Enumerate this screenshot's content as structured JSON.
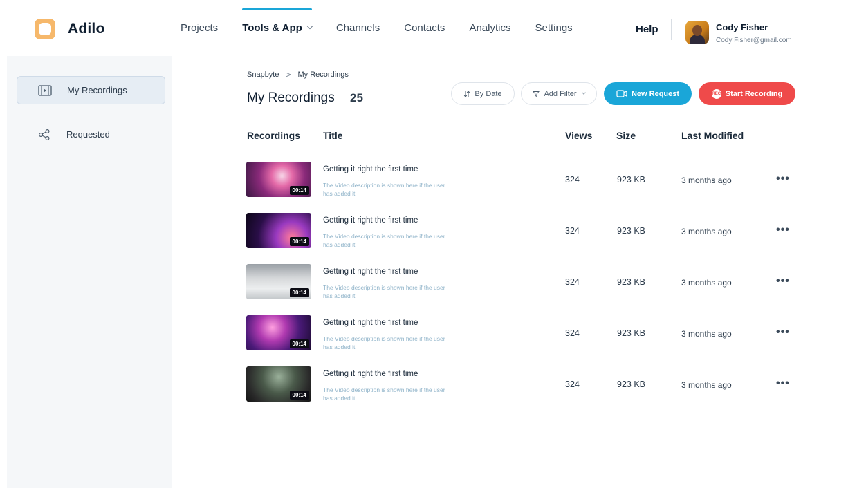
{
  "app": {
    "name": "Adilo"
  },
  "nav": {
    "items": [
      {
        "label": "Projects",
        "active": false
      },
      {
        "label": "Tools & App",
        "active": true
      },
      {
        "label": "Channels",
        "active": false
      },
      {
        "label": "Contacts",
        "active": false
      },
      {
        "label": "Analytics",
        "active": false
      },
      {
        "label": "Settings",
        "active": false
      }
    ],
    "help": "Help"
  },
  "user": {
    "name": "Cody Fisher",
    "email": "Cody Fisher@gmail.com"
  },
  "sidebar": {
    "items": [
      {
        "label": "My Recordings",
        "icon": "film-icon",
        "active": true
      },
      {
        "label": "Requested",
        "icon": "share-icon",
        "active": false
      }
    ]
  },
  "breadcrumb": {
    "root": "Snapbyte",
    "separator": ">",
    "current": "My Recordings"
  },
  "page": {
    "title": "My Recordings",
    "count": "25"
  },
  "toolbar": {
    "sort_label": "By Date",
    "filter_label": "Add Filter",
    "new_request_label": "New Request",
    "start_recording_label": "Start Recording",
    "rec_badge": "REC"
  },
  "table": {
    "headers": {
      "recordings": "Recordings",
      "title": "Title",
      "views": "Views",
      "size": "Size",
      "modified": "Last Modified"
    },
    "rows": [
      {
        "duration": "00:14",
        "title": "Getting it right the first time",
        "description": "The Video description is shown here if the user has added it.",
        "views": "324",
        "size": "923 KB",
        "modified": "3 months ago",
        "more": "•••"
      },
      {
        "duration": "00:14",
        "title": "Getting it right the first time",
        "description": "The Video description is shown here if the user has added it.",
        "views": "324",
        "size": "923 KB",
        "modified": "3 months ago",
        "more": "•••"
      },
      {
        "duration": "00:14",
        "title": "Getting it right the first time",
        "description": "The Video description is shown here if the user has added it.",
        "views": "324",
        "size": "923 KB",
        "modified": "3 months ago",
        "more": "•••"
      },
      {
        "duration": "00:14",
        "title": "Getting it right the first time",
        "description": "The Video description is shown here if the user has added it.",
        "views": "324",
        "size": "923 KB",
        "modified": "3 months ago",
        "more": "•••"
      },
      {
        "duration": "00:14",
        "title": "Getting it right the first time",
        "description": "The Video description is shown here if the user has added it.",
        "views": "324",
        "size": "923 KB",
        "modified": "3 months ago",
        "more": "•••"
      }
    ]
  },
  "colors": {
    "accent": "#1aa6d8",
    "record": "#ef4a4a",
    "logo": "#f6b86b"
  }
}
